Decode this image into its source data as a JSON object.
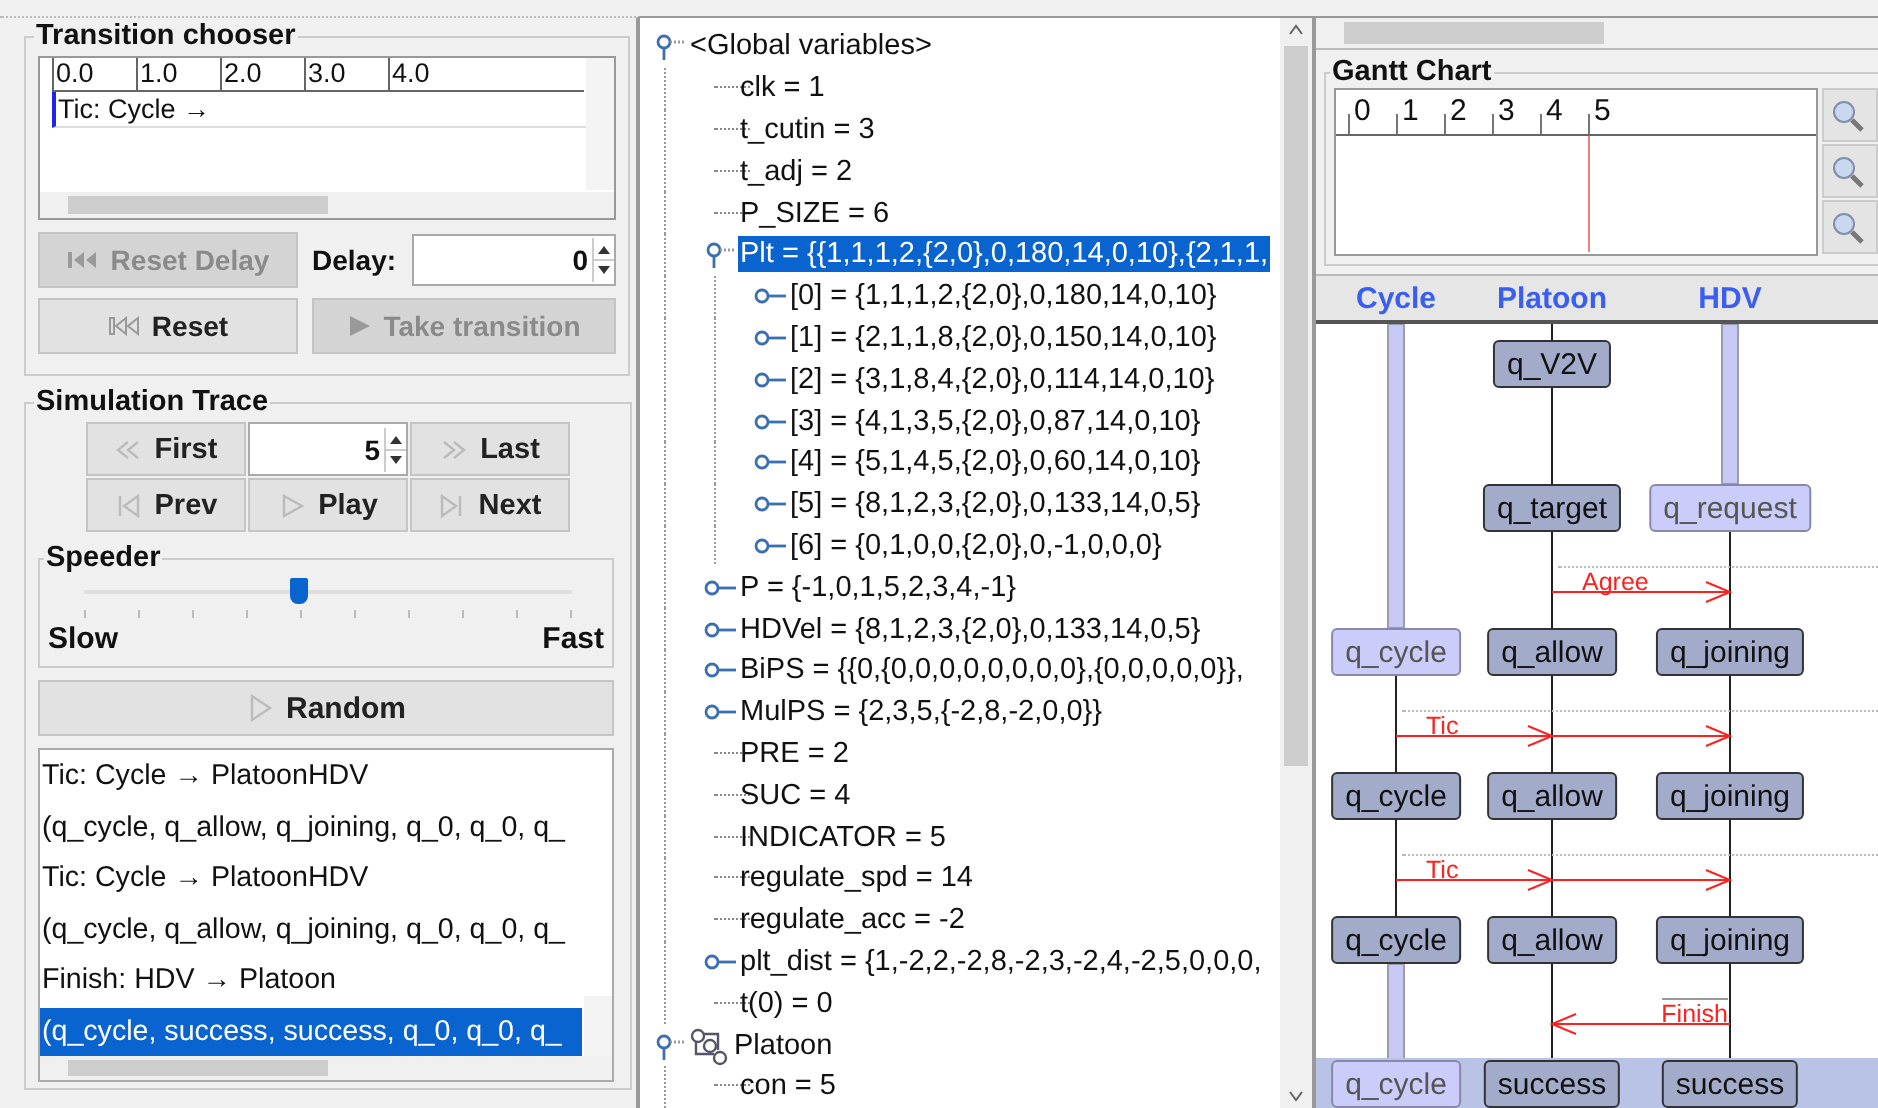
{
  "transition_chooser": {
    "title": "Transition chooser",
    "ticks": [
      "0.0",
      "1.0",
      "2.0",
      "3.0",
      "4.0"
    ],
    "transitions": [
      {
        "label": "Tic: Cycle →",
        "selected": false
      }
    ],
    "buttons": [
      {
        "label": "Reset Delay",
        "kind": "reset-delay",
        "disabled": true
      },
      {
        "label": "Reset",
        "kind": "reset",
        "disabled": false
      },
      {
        "label": "Take transition",
        "kind": "take",
        "disabled": true
      }
    ],
    "delay": {
      "label": "Delay:",
      "value": "0"
    }
  },
  "simulation_trace": {
    "title": "Simulation Trace",
    "step": "5",
    "nav_buttons": [
      {
        "label": "First",
        "kind": "first"
      },
      {
        "label": "Last",
        "kind": "last"
      },
      {
        "label": "Prev",
        "kind": "prev"
      },
      {
        "label": "Play",
        "kind": "play"
      },
      {
        "label": "Next",
        "kind": "next"
      }
    ],
    "speeder": {
      "title": "Speeder",
      "min_label": "Slow",
      "max_label": "Fast",
      "level": 0.44
    },
    "random_button": "Random",
    "trace": [
      {
        "text": "Tic: Cycle → PlatoonHDV",
        "selected": false
      },
      {
        "text": "(q_cycle, q_allow, q_joining, q_0, q_0, q_",
        "selected": false
      },
      {
        "text": "Tic: Cycle → PlatoonHDV",
        "selected": false
      },
      {
        "text": "(q_cycle, q_allow, q_joining, q_0, q_0, q_",
        "selected": false
      },
      {
        "text": "Finish: HDV → Platoon",
        "selected": false
      },
      {
        "text": "(q_cycle, success, success, q_0, q_0, q_",
        "selected": true
      }
    ]
  },
  "variables": [
    {
      "label": "<Global variables>",
      "kind": "group",
      "expanded": true,
      "selected": false,
      "children": [
        {
          "label": "clk = 1",
          "selected": false
        },
        {
          "label": "t_cutin = 3",
          "selected": false
        },
        {
          "label": "t_adj = 2",
          "selected": false
        },
        {
          "label": "P_SIZE = 6",
          "selected": false
        },
        {
          "label": "Plt = {{1,1,1,2,{2,0},0,180,14,0,10},{2,1,1,",
          "selected": true,
          "expanded": true,
          "children": [
            {
              "label": "[0] = {1,1,1,2,{2,0},0,180,14,0,10}",
              "selected": false,
              "expanded": false
            },
            {
              "label": "[1] = {2,1,1,8,{2,0},0,150,14,0,10}",
              "selected": false,
              "expanded": false
            },
            {
              "label": "[2] = {3,1,8,4,{2,0},0,114,14,0,10}",
              "selected": false,
              "expanded": false
            },
            {
              "label": "[3] = {4,1,3,5,{2,0},0,87,14,0,10}",
              "selected": false,
              "expanded": false
            },
            {
              "label": "[4] = {5,1,4,5,{2,0},0,60,14,0,10}",
              "selected": false,
              "expanded": false
            },
            {
              "label": "[5] = {8,1,2,3,{2,0},0,133,14,0,5}",
              "selected": false,
              "expanded": false
            },
            {
              "label": "[6] = {0,1,0,0,{2,0},0,-1,0,0,0}",
              "selected": false,
              "expanded": false
            }
          ]
        },
        {
          "label": "P = {-1,0,1,5,2,3,4,-1}",
          "selected": false,
          "expanded": false
        },
        {
          "label": "HDVel = {8,1,2,3,{2,0},0,133,14,0,5}",
          "selected": false,
          "expanded": false
        },
        {
          "label": "BiPS = {{0,{0,0,0,0,0,0,0,0},{0,0,0,0,0}},",
          "selected": false,
          "expanded": false
        },
        {
          "label": "MulPS = {2,3,5,{-2,8,-2,0,0}}",
          "selected": false,
          "expanded": false
        },
        {
          "label": "PRE = 2",
          "selected": false
        },
        {
          "label": "SUC = 4",
          "selected": false
        },
        {
          "label": "INDICATOR = 5",
          "selected": false
        },
        {
          "label": "regulate_spd = 14",
          "selected": false
        },
        {
          "label": "regulate_acc = -2",
          "selected": false
        },
        {
          "label": "plt_dist = {1,-2,2,-2,8,-2,3,-2,4,-2,5,0,0,0,",
          "selected": false,
          "expanded": false
        },
        {
          "label": "t(0) = 0",
          "selected": false
        }
      ]
    },
    {
      "label": "Platoon",
      "kind": "process",
      "expanded": true,
      "selected": false,
      "children": [
        {
          "label": "con = 5",
          "selected": false
        }
      ]
    }
  ],
  "gantt": {
    "title": "Gantt Chart",
    "ticks": [
      {
        "label": "0",
        "selected": false
      },
      {
        "label": "1",
        "selected": false
      },
      {
        "label": "2",
        "selected": false
      },
      {
        "label": "3",
        "selected": false
      },
      {
        "label": "4",
        "selected": false
      },
      {
        "label": "5",
        "selected": true
      }
    ]
  },
  "sequence": {
    "processes": [
      "Cycle",
      "Platoon",
      "HDV"
    ],
    "steps": [
      {
        "selected": false,
        "states": [
          {
            "kind": "empty"
          },
          {
            "label": "q_V2V",
            "kind": "changed"
          },
          {
            "kind": "empty"
          }
        ]
      },
      {
        "selected": false,
        "states": [
          {
            "kind": "empty"
          },
          {
            "label": "q_target",
            "kind": "changed"
          },
          {
            "label": "q_request",
            "kind": "unchanged"
          }
        ]
      },
      {
        "selected": false,
        "message": {
          "label": "Agree",
          "kind": "platoon-to-hdv"
        },
        "states": [
          {
            "label": "q_cycle",
            "kind": "unchanged"
          },
          {
            "label": "q_allow",
            "kind": "changed"
          },
          {
            "label": "q_joining",
            "kind": "changed"
          }
        ]
      },
      {
        "selected": false,
        "message": {
          "label": "Tic",
          "kind": "cycle-broadcast"
        },
        "states": [
          {
            "label": "q_cycle",
            "kind": "changed"
          },
          {
            "label": "q_allow",
            "kind": "changed"
          },
          {
            "label": "q_joining",
            "kind": "changed"
          }
        ]
      },
      {
        "selected": false,
        "message": {
          "label": "Tic",
          "kind": "cycle-broadcast"
        },
        "states": [
          {
            "label": "q_cycle",
            "kind": "changed"
          },
          {
            "label": "q_allow",
            "kind": "changed"
          },
          {
            "label": "q_joining",
            "kind": "changed"
          }
        ]
      },
      {
        "selected": true,
        "message": {
          "label": "Finish",
          "kind": "hdv-to-platoon"
        },
        "states": [
          {
            "label": "q_cycle",
            "kind": "unchanged"
          },
          {
            "label": "success",
            "kind": "changed"
          },
          {
            "label": "success",
            "kind": "changed"
          }
        ]
      }
    ]
  }
}
